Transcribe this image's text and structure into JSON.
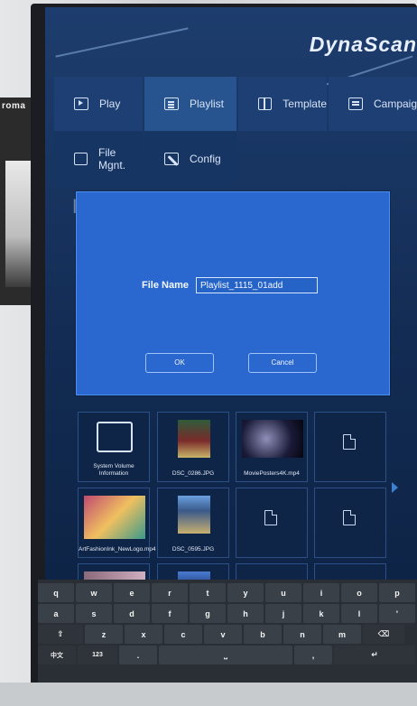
{
  "app": {
    "brand": "DynaScan"
  },
  "surroundings": {
    "poster_text": "roma"
  },
  "nav": [
    {
      "id": "play",
      "label": "Play",
      "icon": "play-icon",
      "active": false
    },
    {
      "id": "playlist",
      "label": "Playlist",
      "icon": "list-icon",
      "active": true
    },
    {
      "id": "template",
      "label": "Template",
      "icon": "template-icon",
      "active": false
    },
    {
      "id": "campaign",
      "label": "Campaign",
      "icon": "campaign-icon",
      "active": false
    },
    {
      "id": "filemgnt",
      "label": "File Mgnt.",
      "icon": "folder-icon",
      "active": false
    },
    {
      "id": "config",
      "label": "Config",
      "icon": "wrench-icon",
      "active": false
    }
  ],
  "page": {
    "heading_partial": "P"
  },
  "dialog": {
    "field_label": "File Name",
    "field_value": "Playlist_1115_01add",
    "ok_label": "OK",
    "cancel_label": "Cancel"
  },
  "files": [
    {
      "name": "System Volume Information",
      "type": "folder"
    },
    {
      "name": "DSC_0286.JPG",
      "type": "image"
    },
    {
      "name": "MoviePosters4K.mp4",
      "type": "video"
    },
    {
      "name": "",
      "type": "file"
    },
    {
      "name": "ArtFashionInk_NewLogo.mp4",
      "type": "video"
    },
    {
      "name": "DSC_0595.JPG",
      "type": "image"
    },
    {
      "name": "",
      "type": "file"
    },
    {
      "name": "",
      "type": "file"
    }
  ],
  "keyboard": {
    "row1": [
      "q",
      "w",
      "e",
      "r",
      "t",
      "y",
      "u",
      "i",
      "o",
      "p"
    ],
    "row2": [
      "a",
      "s",
      "d",
      "f",
      "g",
      "h",
      "j",
      "k",
      "l",
      "'"
    ],
    "row3": [
      "⇧",
      "z",
      "x",
      "c",
      "v",
      "b",
      "n",
      "m",
      "⌫"
    ],
    "row4": [
      "中文",
      "123",
      ".",
      "⎵",
      ",",
      "↵"
    ]
  },
  "colors": {
    "accent": "#2a67cf",
    "background": "#122b52"
  }
}
